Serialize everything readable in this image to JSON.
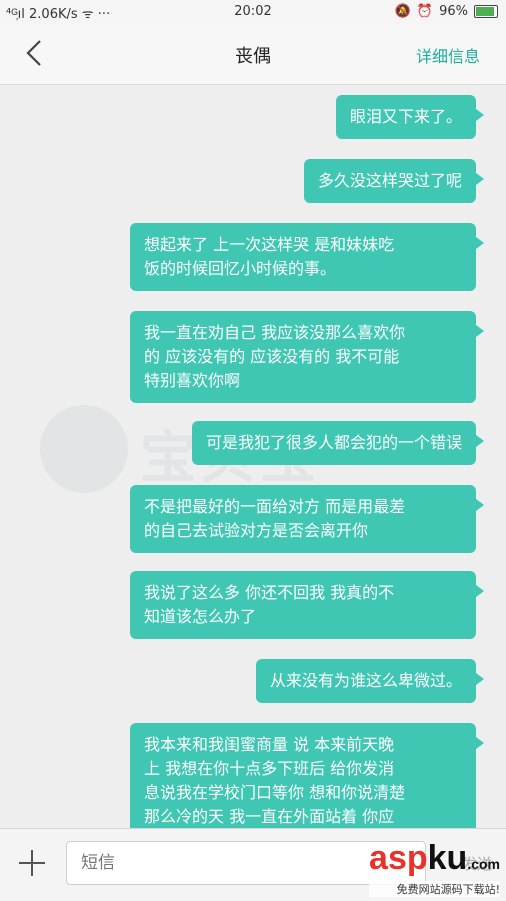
{
  "status_bar": {
    "left": "⁴ᴳ᷊ıl 2.06K/s ᯤ ···",
    "time": "20:02",
    "battery": "96%",
    "battery_level": 0.96
  },
  "header": {
    "title": "丧偶",
    "details_label": "详细信息"
  },
  "messages": [
    "眼泪又下来了。",
    "多久没这样哭过了呢",
    "想起来了 上一次这样哭 是和妹妹吃\n饭的时候回忆小时候的事。",
    "我一直在劝自己 我应该没那么喜欢你\n的 应该没有的 应该没有的 我不可能\n特别喜欢你啊",
    "可是我犯了很多人都会犯的一个错误",
    "不是把最好的一面给对方 而是用最差\n的自己去试验对方是否会离开你",
    "我说了这么多 你还不回我 我真的不\n知道该怎么办了",
    "从来没有为谁这么卑微过。",
    "我本来和我闺蜜商量 说 本来前天晚\n上 我想在你十点多下班后 给你发消\n息说我在学校门口等你 想和你说清楚\n那么冷的天 我一直在外面站着 你应\n该会心疼 然后就和我说明白"
  ],
  "watermark": "宝贝宝",
  "composer": {
    "placeholder": "短信",
    "send_label": "发送"
  },
  "site_watermark": {
    "brand_a": "asp",
    "brand_b": "ku",
    "brand_c": ".com",
    "tagline": "免费网站源码下载站!"
  },
  "colors": {
    "bubble": "#3fc7b4",
    "accent": "#1fae9a"
  }
}
